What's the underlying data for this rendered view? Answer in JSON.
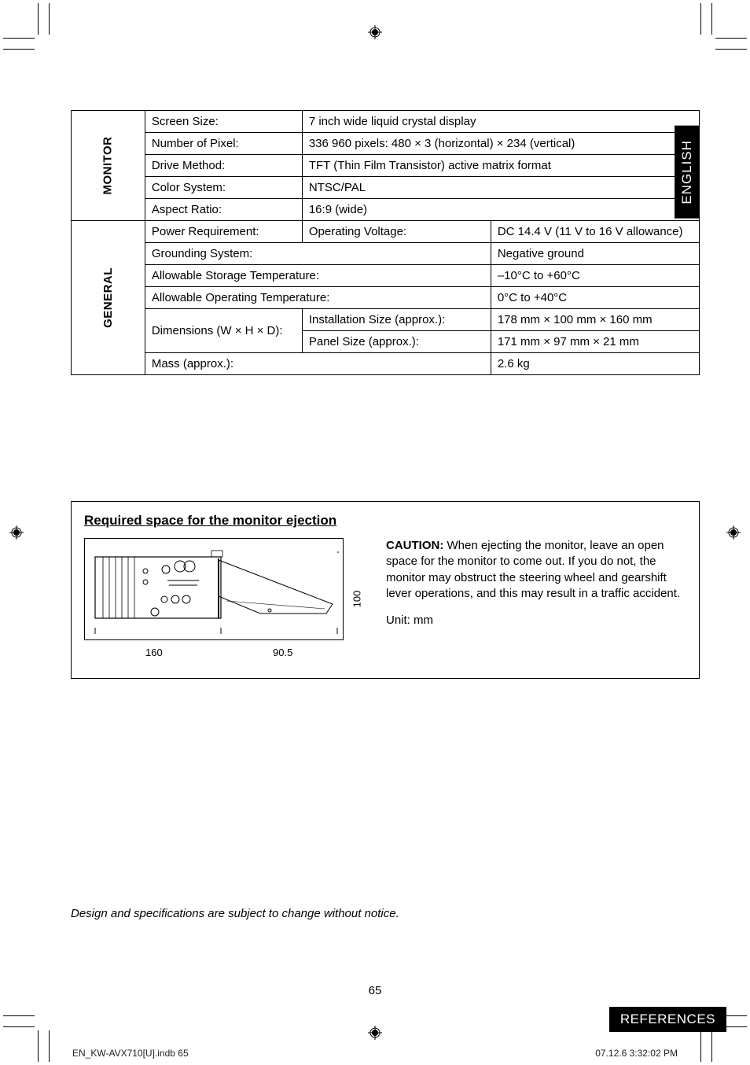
{
  "lang_tab": "ENGLISH",
  "spec_table": {
    "monitor_header": "MONITOR",
    "general_header": "GENERAL",
    "rows": {
      "screen_size_label": "Screen Size:",
      "screen_size_value": "7 inch wide liquid crystal display",
      "num_pixel_label": "Number of Pixel:",
      "num_pixel_value": "336 960 pixels: 480 × 3 (horizontal) × 234 (vertical)",
      "drive_method_label": "Drive Method:",
      "drive_method_value": "TFT (Thin Film Transistor) active matrix format",
      "color_system_label": "Color System:",
      "color_system_value": "NTSC/PAL",
      "aspect_ratio_label": "Aspect Ratio:",
      "aspect_ratio_value": "16:9 (wide)",
      "power_req_label": "Power Requirement:",
      "op_voltage_label": "Operating Voltage:",
      "op_voltage_value": "DC 14.4 V (11 V to 16 V allowance)",
      "grounding_label": "Grounding System:",
      "grounding_value": "Negative ground",
      "storage_temp_label": "Allowable Storage Temperature:",
      "storage_temp_value": "–10°C to +60°C",
      "op_temp_label": "Allowable Operating Temperature:",
      "op_temp_value": "0°C to +40°C",
      "dimensions_label": "Dimensions (W × H × D):",
      "install_size_label": "Installation Size (approx.):",
      "install_size_value": "178 mm × 100 mm × 160 mm",
      "panel_size_label": "Panel Size (approx.):",
      "panel_size_value": "171 mm × 97 mm × 21 mm",
      "mass_label": "Mass (approx.):",
      "mass_value": "2.6 kg"
    }
  },
  "required_space": {
    "title": "Required space for the monitor ejection",
    "dim_160": "160",
    "dim_905": "90.5",
    "dim_100": "100",
    "caution_label": "CAUTION:",
    "caution_text": " When ejecting the monitor, leave an open space for the monitor to come out. If you do not, the monitor may obstruct the steering wheel and gearshift lever operations, and this may result in a traffic accident.",
    "unit_label": "Unit: mm"
  },
  "design_note": "Design and specifications are subject to change without notice.",
  "page_number": "65",
  "references_label": "REFERENCES",
  "footer_file": "EN_KW-AVX710[U].indb   65",
  "footer_timestamp": "07.12.6   3:32:02 PM"
}
